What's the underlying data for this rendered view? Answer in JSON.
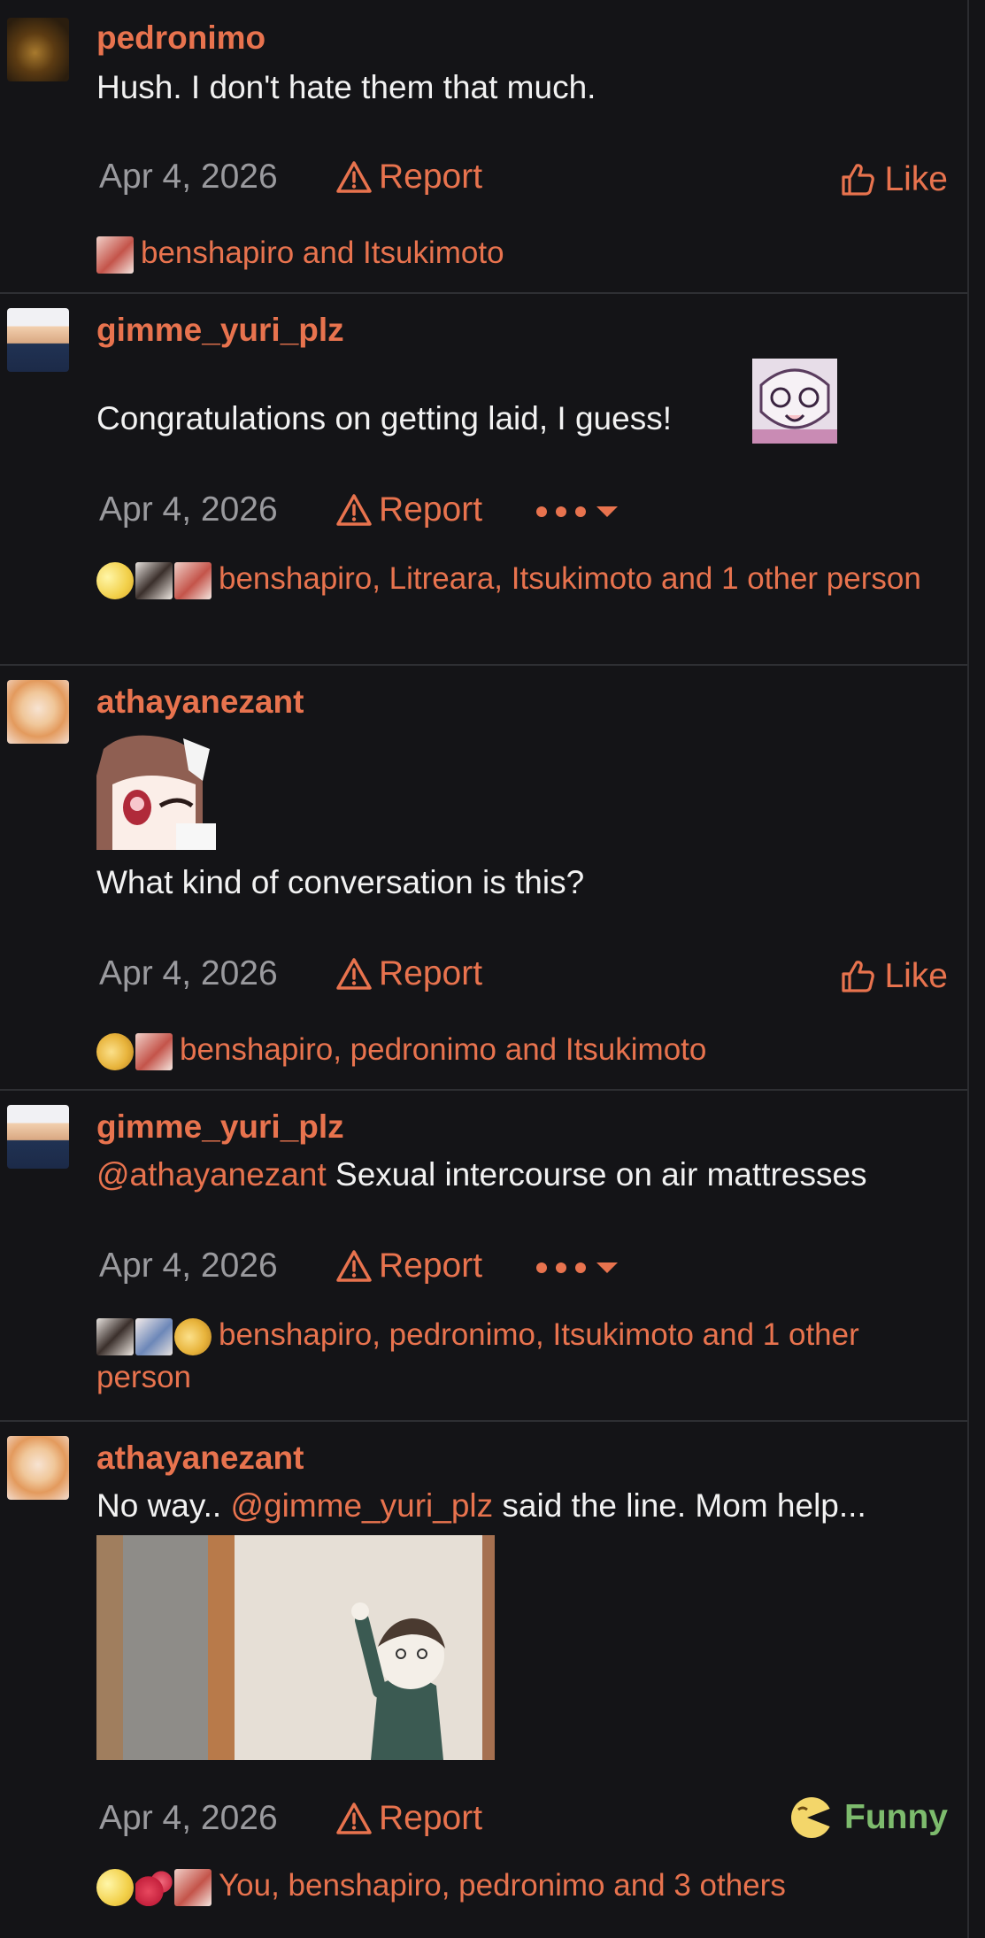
{
  "posts": [
    {
      "username": "pedronimo",
      "message": "Hush. I don't hate them that much.",
      "date": "Apr 4, 2026",
      "report_label": "Report",
      "action_label": "Like",
      "reactions_text": "benshapiro and Itsukimoto"
    },
    {
      "username": "gimme_yuri_plz",
      "message": "Congratulations on getting laid, I guess!",
      "date": "Apr 4, 2026",
      "report_label": "Report",
      "reactions_text": "benshapiro, Litreara, Itsukimoto and 1 other person"
    },
    {
      "username": "athayanezant",
      "message": "What kind of conversation is this?",
      "date": "Apr 4, 2026",
      "report_label": "Report",
      "action_label": "Like",
      "reactions_text": "benshapiro, pedronimo and Itsukimoto"
    },
    {
      "username": "gimme_yuri_plz",
      "mention": "@athayanezant",
      "message": " Sexual intercourse on air mattresses",
      "date": "Apr 4, 2026",
      "report_label": "Report",
      "reactions_text": "benshapiro, pedronimo, Itsukimoto and 1 other person"
    },
    {
      "username": "athayanezant",
      "message_before": "No way.. ",
      "mention": "@gimme_yuri_plz",
      "message_after": " said the line. Mom help...",
      "date": "Apr 4, 2026",
      "report_label": "Report",
      "reaction_label": "Funny",
      "reactions_text": "You, benshapiro, pedronimo and 3 others"
    }
  ],
  "colors": {
    "accent": "#e8734e",
    "funny": "#7dbb6d",
    "background": "#141417",
    "muted": "#9a9a9e"
  }
}
